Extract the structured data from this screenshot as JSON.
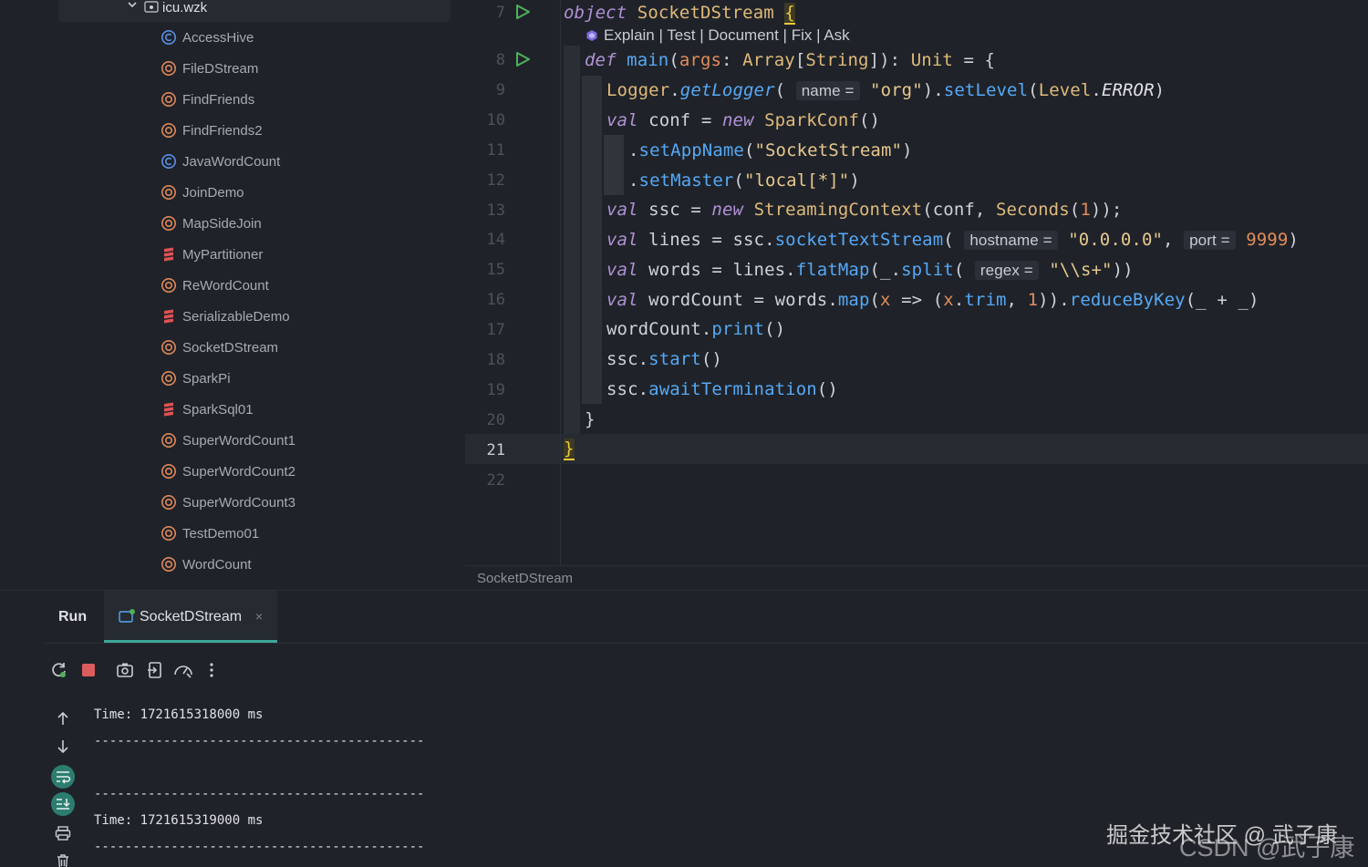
{
  "project_tree": {
    "root_label": "icu.wzk",
    "items": [
      {
        "label": "AccessHive",
        "icon": "class-icon",
        "kind": "class"
      },
      {
        "label": "FileDStream",
        "icon": "object-icon",
        "kind": "object"
      },
      {
        "label": "FindFriends",
        "icon": "object-icon",
        "kind": "object"
      },
      {
        "label": "FindFriends2",
        "icon": "object-icon",
        "kind": "object"
      },
      {
        "label": "JavaWordCount",
        "icon": "class-icon",
        "kind": "class"
      },
      {
        "label": "JoinDemo",
        "icon": "object-icon",
        "kind": "object"
      },
      {
        "label": "MapSideJoin",
        "icon": "object-icon",
        "kind": "object"
      },
      {
        "label": "MyPartitioner",
        "icon": "scala-file-icon",
        "kind": "scala"
      },
      {
        "label": "ReWordCount",
        "icon": "object-icon",
        "kind": "object"
      },
      {
        "label": "SerializableDemo",
        "icon": "scala-file-icon",
        "kind": "scala"
      },
      {
        "label": "SocketDStream",
        "icon": "object-icon",
        "kind": "object"
      },
      {
        "label": "SparkPi",
        "icon": "object-icon",
        "kind": "object"
      },
      {
        "label": "SparkSql01",
        "icon": "scala-file-icon",
        "kind": "scala"
      },
      {
        "label": "SuperWordCount1",
        "icon": "object-icon",
        "kind": "object"
      },
      {
        "label": "SuperWordCount2",
        "icon": "object-icon",
        "kind": "object"
      },
      {
        "label": "SuperWordCount3",
        "icon": "object-icon",
        "kind": "object"
      },
      {
        "label": "TestDemo01",
        "icon": "object-icon",
        "kind": "object"
      },
      {
        "label": "WordCount",
        "icon": "object-icon",
        "kind": "object"
      }
    ]
  },
  "editor": {
    "line_numbers": [
      "7",
      "8",
      "9",
      "10",
      "11",
      "12",
      "13",
      "14",
      "15",
      "16",
      "17",
      "18",
      "19",
      "20",
      "21",
      "22"
    ],
    "current_line": "21",
    "codelens": "Explain | Test | Document | Fix | Ask",
    "code": {
      "l7": {
        "kw": "object",
        "name": "SocketDStream",
        "brace": "{"
      },
      "l8": {
        "kw": "def",
        "fn": "main",
        "p1": "(",
        "arg": "args",
        "p2": ": ",
        "t1": "Array",
        "p3": "[",
        "t2": "String",
        "p4": "]): ",
        "t3": "Unit",
        "p5": " = {"
      },
      "l9": {
        "obj": "Logger",
        "dot1": ".",
        "fn1": "getLogger",
        "p1": "(",
        "hint": "name =",
        "str": " \"org\"",
        "p2": ").",
        "fn2": "setLevel",
        "p3": "(",
        "obj2": "Level",
        "dot2": ".",
        "cst": "ERROR",
        "p4": ")"
      },
      "l10": {
        "kw": "val",
        "v": " conf = ",
        "kw2": "new",
        "cls": " SparkConf",
        "p": "()"
      },
      "l11": {
        "dot": ".",
        "fn": "setAppName",
        "p1": "(",
        "str": "\"SocketStream\"",
        "p2": ")"
      },
      "l12": {
        "dot": ".",
        "fn": "setMaster",
        "p1": "(",
        "str": "\"local[*]\"",
        "p2": ")"
      },
      "l13": {
        "kw": "val",
        "v": " ssc = ",
        "kw2": "new",
        "cls": " StreamingContext",
        "p1": "(conf, ",
        "cls2": "Seconds",
        "p2": "(",
        "num": "1",
        "p3": "));"
      },
      "l14": {
        "kw": "val",
        "v": " lines = ssc.",
        "fn": "socketTextStream",
        "p1": "( ",
        "hint1": "hostname =",
        "str": " \"0.0.0.0\"",
        "p2": ", ",
        "hint2": "port =",
        "num": " 9999",
        "p3": ")"
      },
      "l15": {
        "kw": "val",
        "v": " words = lines.",
        "fn": "flatMap",
        "p1": "(_.",
        "fn2": "split",
        "p2": "( ",
        "hint": "regex =",
        "str": " \"\\\\s+\"",
        "p3": "))"
      },
      "l16": {
        "kw": "val",
        "v": " wordCount = words.",
        "fn": "map",
        "p1": "(",
        "x1": "x",
        "p2": " => (",
        "x2": "x",
        "p3": ".",
        "fn2": "trim",
        "p4": ", ",
        "num": "1",
        "p5": ")).",
        "fn3": "reduceByKey",
        "p6": "(_ + _)"
      },
      "l17": {
        "v": "wordCount.",
        "fn": "print",
        "p": "()"
      },
      "l18": {
        "v": "ssc.",
        "fn": "start",
        "p": "()"
      },
      "l19": {
        "v": "ssc.",
        "fn": "awaitTermination",
        "p": "()"
      },
      "l20": {
        "p": "}"
      },
      "l21": {
        "p": "}"
      }
    },
    "breadcrumb": "SocketDStream"
  },
  "run_panel": {
    "title": "Run",
    "tab_label": "SocketDStream",
    "tab_close": "×",
    "toolbar_icons": [
      "rerun-icon",
      "stop-icon",
      "screenshot-icon",
      "exit-icon",
      "profiler-icon",
      "more-icon"
    ],
    "side_icons": [
      "scroll-up-icon",
      "scroll-down-icon",
      "soft-wrap-icon",
      "scroll-to-end-icon",
      "print-icon",
      "trash-icon"
    ],
    "console_lines": [
      "Time: 1721615318000 ms",
      "-------------------------------------------",
      "",
      "-------------------------------------------",
      "Time: 1721615319000 ms",
      "-------------------------------------------"
    ]
  },
  "watermark": {
    "line1": "掘金技术社区 @ 武子康",
    "line2": "CSDN @武子康"
  },
  "colors": {
    "background": "#1f2329",
    "keyword": "#b291d6",
    "function": "#56a8f5",
    "class": "#e0b97a",
    "string": "#e7c78e",
    "number": "#e38b5a",
    "object_icon": "#e0875a",
    "class_icon": "#5c8fe6",
    "run_green": "#4fb05a",
    "tab_accent": "#3ea796"
  }
}
